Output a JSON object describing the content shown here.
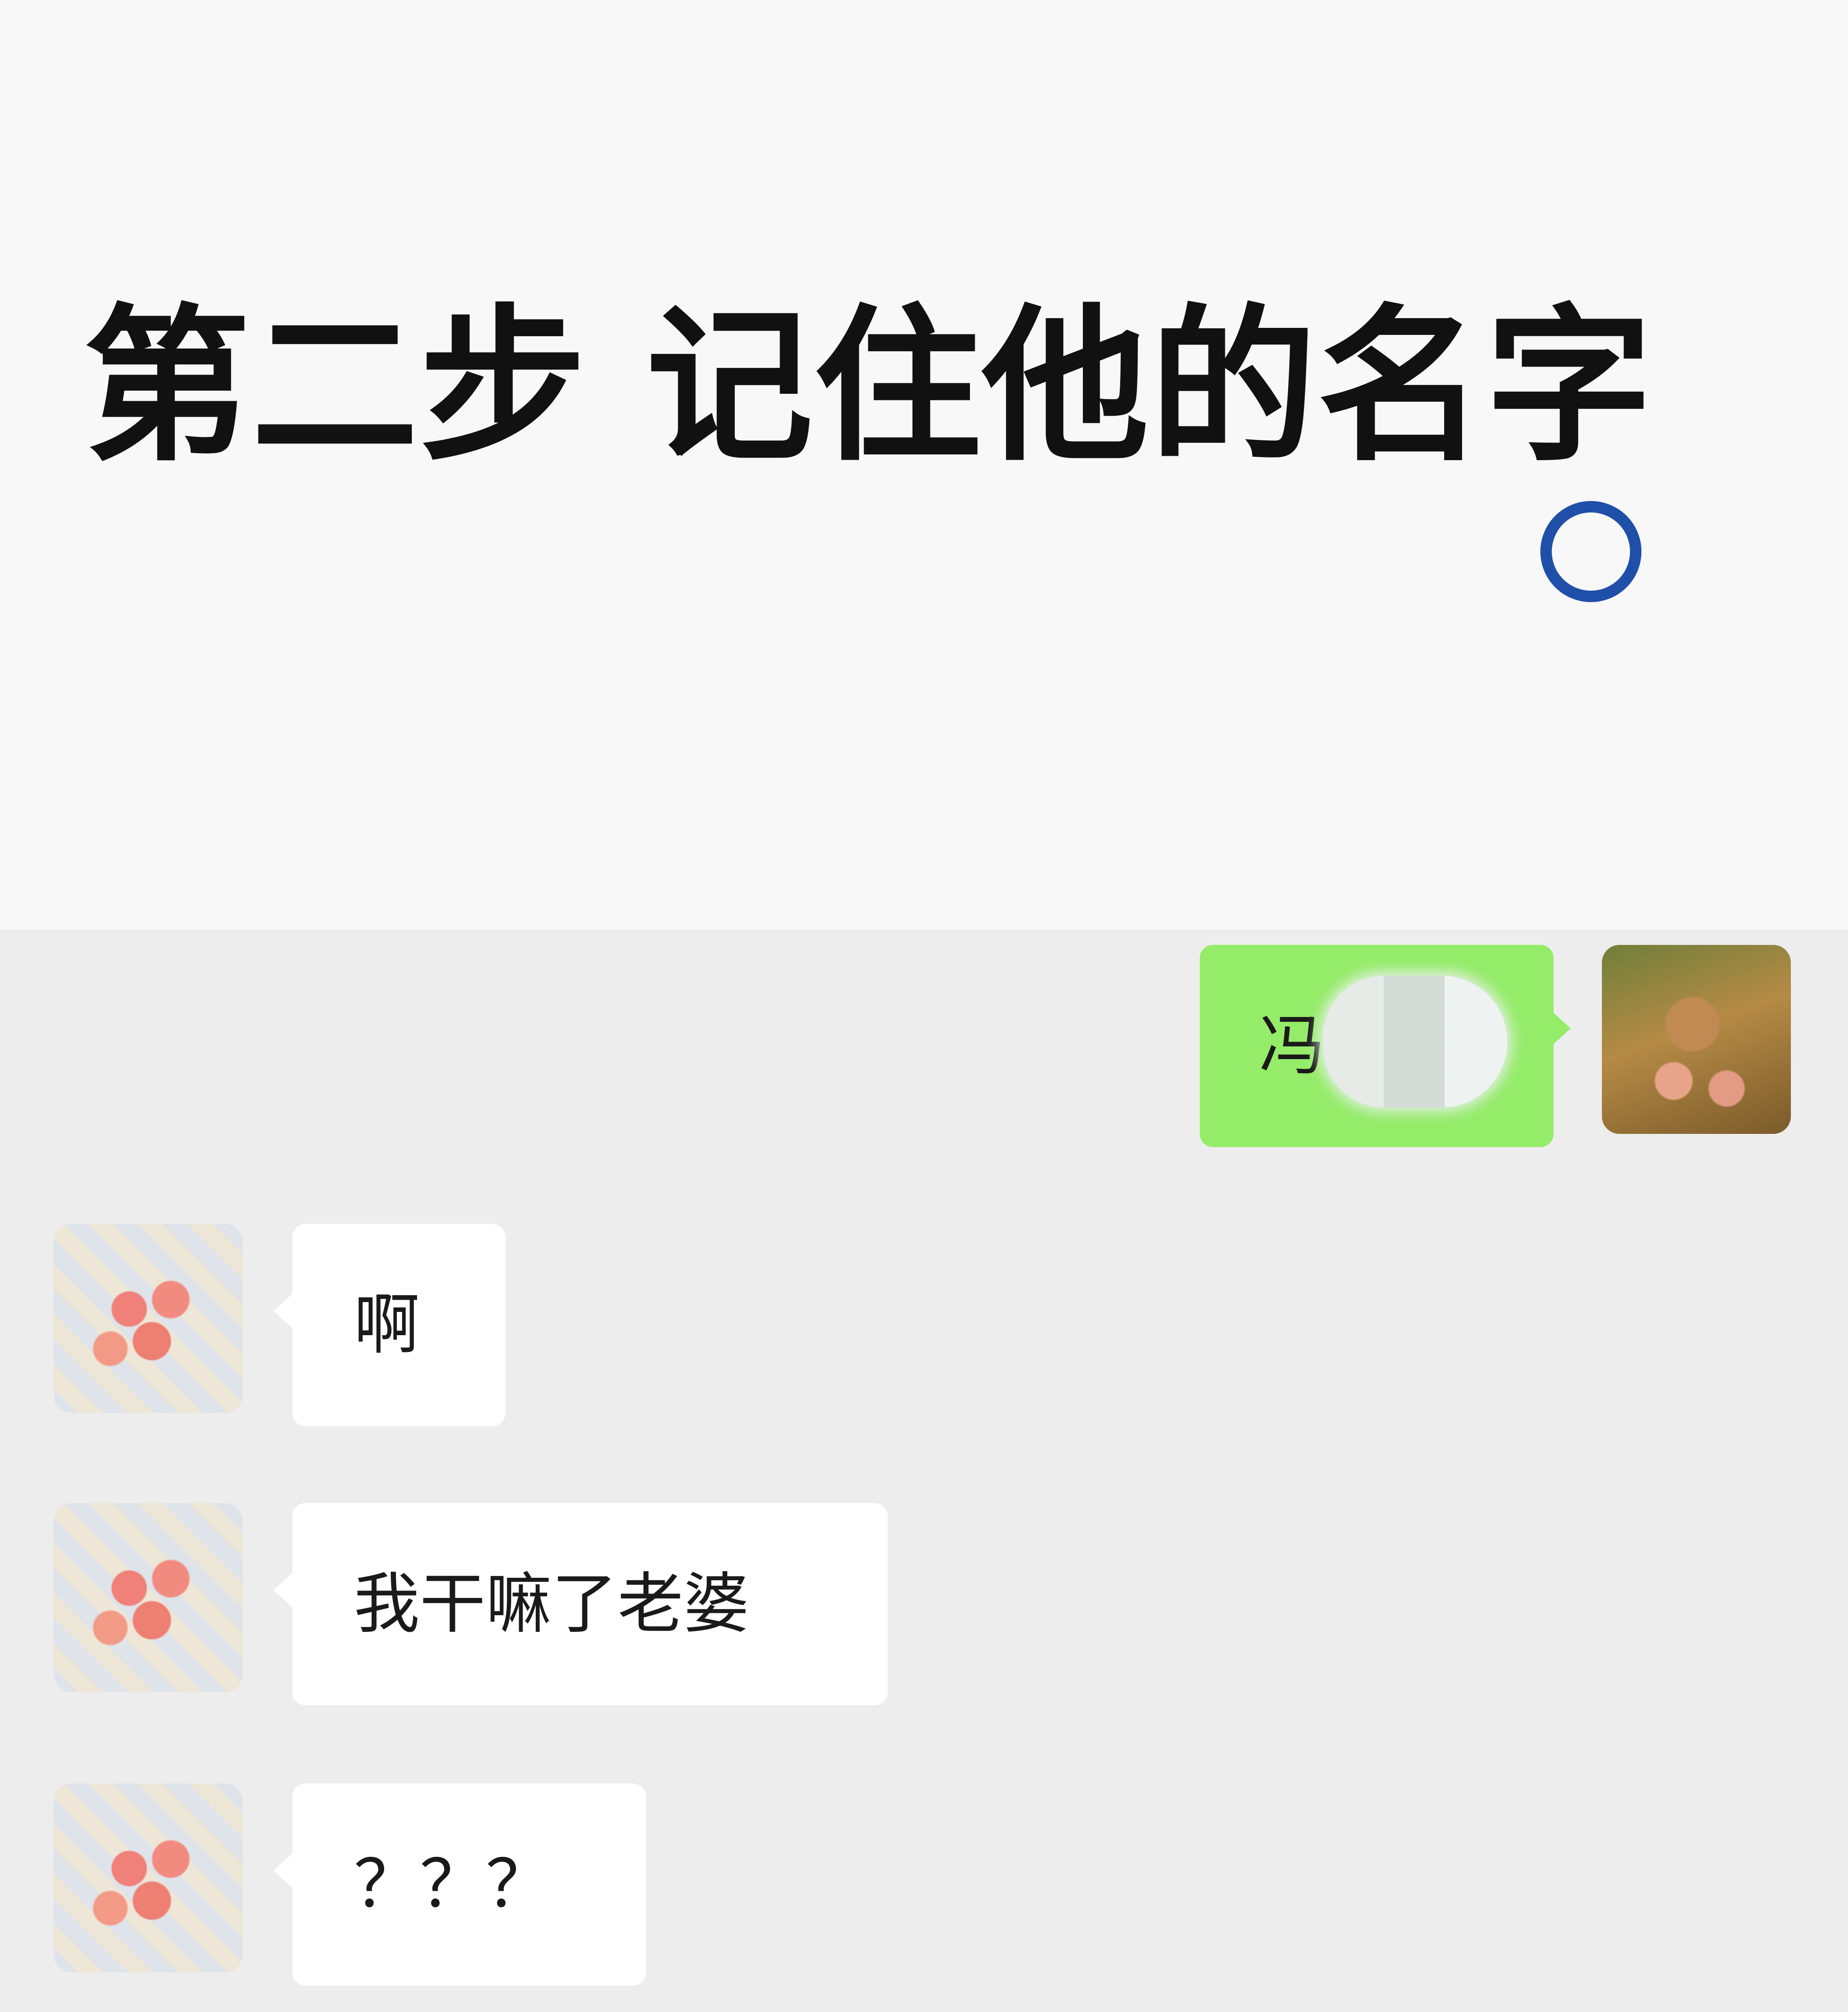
{
  "banner": {
    "title": "第二步 记住他的名字"
  },
  "messages": [
    {
      "side": "right",
      "sender": "me",
      "text": "冯"
    },
    {
      "side": "left",
      "sender": "contact",
      "text": "啊"
    },
    {
      "side": "left",
      "sender": "contact",
      "text": "我干嘛了老婆"
    },
    {
      "side": "left",
      "sender": "contact",
      "text": "？？？"
    }
  ],
  "colors": {
    "chat_background": "#ededed",
    "my_bubble": "#95ec69",
    "their_bubble": "#ffffff",
    "ring": "#1f4fa8"
  }
}
